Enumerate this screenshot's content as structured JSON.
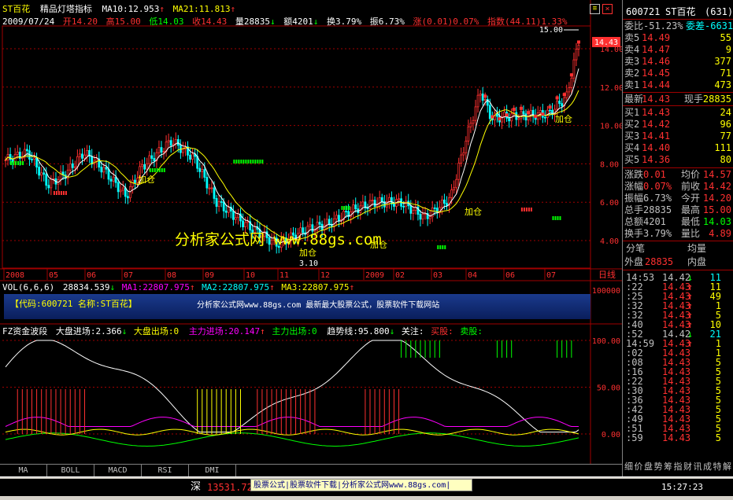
{
  "header": {
    "stock_name": "ST百花",
    "indicator_name": "精品灯塔指标",
    "ma10": "MA10:12.953",
    "ma21": "MA21:11.813",
    "date": "2009/07/24",
    "open": "开14.20",
    "high": "高15.00",
    "low": "低14.03",
    "close": "收14.43",
    "volume": "量28835",
    "amount": "额4201",
    "turnover": "换3.79%",
    "amplitude": "振6.73%",
    "change": "涨(0.01)0.07%",
    "index": "指数(44.11)1.33%"
  },
  "price_axis": {
    "labels": [
      "14.00",
      "12.00",
      "10.00",
      "8.00",
      "6.00",
      "4.00"
    ],
    "current": "14.43",
    "high_mark": "15.00",
    "low_mark": "3.10"
  },
  "time_axis": {
    "labels": [
      "2008",
      "05",
      "06",
      "07",
      "08",
      "09",
      "10",
      "11",
      "12",
      "2009",
      "02",
      "03",
      "04",
      "06",
      "07"
    ],
    "right_label": "日线"
  },
  "signals": {
    "add_labels": [
      "加仓",
      "加仓",
      "加仓",
      "加仓",
      "加仓"
    ]
  },
  "watermark": "分析家公式网 www.88gs.com",
  "volume_panel": {
    "title": "VOL(6,6,6)",
    "vol": "28834.539",
    "ma1": "MA1:22807.975",
    "ma2": "MA2:22807.975",
    "ma3": "MA3:22807.975",
    "banner_left": "【代码:600721 名称:ST百花】",
    "banner_right": "分析家公式网www.88gs.com 最新最大股票公式，股票软件下载网站",
    "axis_label": "100000"
  },
  "fz_panel": {
    "title": "FZ资金波段",
    "big_in": "大盘进场:2.366",
    "big_out": "大盘出场:0",
    "main_in": "主力进场:20.147",
    "main_out": "主力出场:0",
    "trend": "趋势线:95.800",
    "watch": "关注:",
    "buy": "买股:",
    "sell": "卖股:",
    "axis_labels": [
      "100.00",
      "50.00",
      "0.00"
    ]
  },
  "quote_panel": {
    "code": "600721",
    "name": "ST百花",
    "num": "(631)",
    "wei_bi": "委比-51.23%",
    "wei_cha": "委差-6631",
    "sell_rows": [
      {
        "label": "卖5",
        "price": "14.49",
        "vol": "55"
      },
      {
        "label": "卖4",
        "price": "14.47",
        "vol": "9"
      },
      {
        "label": "卖3",
        "price": "14.46",
        "vol": "377"
      },
      {
        "label": "卖2",
        "price": "14.45",
        "vol": "71"
      },
      {
        "label": "卖1",
        "price": "14.44",
        "vol": "473"
      }
    ],
    "latest": {
      "label": "最新",
      "price": "14.43",
      "label2": "现手",
      "val2": "28835"
    },
    "buy_rows": [
      {
        "label": "买1",
        "price": "14.43",
        "vol": "24"
      },
      {
        "label": "买2",
        "price": "14.42",
        "vol": "96"
      },
      {
        "label": "买3",
        "price": "14.41",
        "vol": "77"
      },
      {
        "label": "买4",
        "price": "14.40",
        "vol": "111"
      },
      {
        "label": "买5",
        "price": "14.36",
        "vol": "80"
      }
    ],
    "stats": [
      {
        "l1": "涨跌",
        "v1": "0.01",
        "l2": "均价",
        "v2": "14.57"
      },
      {
        "l1": "涨幅",
        "v1": "0.07%",
        "l2": "前收",
        "v2": "14.42"
      },
      {
        "l1": "振幅",
        "v1": "6.73%",
        "l2": "今开",
        "v2": "14.20"
      },
      {
        "l1": "总手",
        "v1": "28835",
        "l2": "最高",
        "v2": "15.00"
      },
      {
        "l1": "总额",
        "v1": "4201",
        "l2": "最低",
        "v2": "14.03"
      },
      {
        "l1": "换手",
        "v1": "3.79%",
        "l2": "量比",
        "v2": "4.89"
      }
    ],
    "fen_bi": "分笔",
    "jun_liang": "均量",
    "wai_pan": "外盘",
    "wai_val": "28835",
    "nei_pan": "内盘",
    "ticks": [
      {
        "t": "14:53",
        "p": "14.42",
        "a": "↓",
        "v": "11"
      },
      {
        "t": ":22",
        "p": "14.43",
        "a": "↑",
        "v": "11"
      },
      {
        "t": ":25",
        "p": "14.43",
        "a": "↑",
        "v": "49"
      },
      {
        "t": ":32",
        "p": "14.43",
        "a": "↑",
        "v": "1"
      },
      {
        "t": ":32",
        "p": "14.43",
        "a": "↑",
        "v": "5"
      },
      {
        "t": ":40",
        "p": "14.43",
        "a": "↑",
        "v": "10"
      },
      {
        "t": ":52",
        "p": "14.42",
        "a": "↓",
        "v": "21"
      },
      {
        "t": "14:59",
        "p": "14.43",
        "a": "↑",
        "v": "1"
      },
      {
        "t": ":02",
        "p": "14.43",
        "a": "",
        "v": "1"
      },
      {
        "t": ":08",
        "p": "14.43",
        "a": "",
        "v": "5"
      },
      {
        "t": ":16",
        "p": "14.43",
        "a": "",
        "v": "5"
      },
      {
        "t": ":22",
        "p": "14.43",
        "a": "",
        "v": "5"
      },
      {
        "t": ":30",
        "p": "14.43",
        "a": "",
        "v": "5"
      },
      {
        "t": ":36",
        "p": "14.43",
        "a": "",
        "v": "5"
      },
      {
        "t": ":42",
        "p": "14.43",
        "a": "",
        "v": "5"
      },
      {
        "t": ":49",
        "p": "14.43",
        "a": "",
        "v": "5"
      },
      {
        "t": ":51",
        "p": "14.43",
        "a": "",
        "v": "5"
      },
      {
        "t": ":59",
        "p": "14.43",
        "a": "",
        "v": "5"
      }
    ],
    "bottom_tabs": [
      "细",
      "价",
      "盘",
      "势",
      "筹",
      "指",
      "财",
      "讯",
      "成",
      "特",
      "解"
    ]
  },
  "bottom_tabs": [
    "MA",
    "BOLL",
    "MACD",
    "RSI",
    "DMI"
  ],
  "status": {
    "market": "深",
    "index_val": "13531.72",
    "ad": "股票公式|股票软件下载|分析家公式网www.88gs.com|",
    "time": "15:27:23"
  },
  "icons": {
    "up_arrow": "↑",
    "down_arrow": "↓",
    "menu": "menu-icon",
    "close": "close-icon"
  },
  "colors": {
    "up": "#ff3030",
    "down": "#00ff00",
    "neutral": "#c0c0c0",
    "yellow": "#ffff00",
    "cyan": "#00ffff",
    "magenta": "#ff00ff"
  }
}
